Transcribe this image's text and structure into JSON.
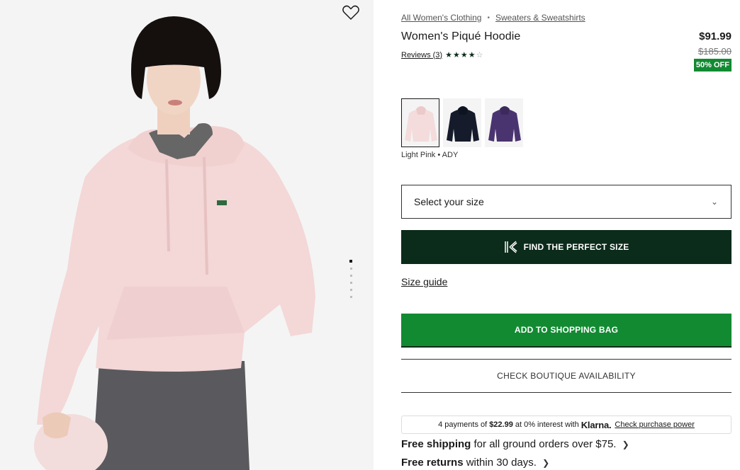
{
  "breadcrumb": {
    "items": [
      "All Women's Clothing",
      "Sweaters & Sweatshirts"
    ],
    "separator": "•"
  },
  "product": {
    "title": "Women's Piqué Hoodie",
    "price": "$91.99",
    "old_price": "$185.00",
    "discount_badge": "50% OFF",
    "reviews_label": "Reviews (3)",
    "rating": 4,
    "rating_max": 5,
    "color_label": "Light Pink • ADY"
  },
  "swatches": [
    {
      "name": "Light Pink",
      "color": "#f4dcdc",
      "selected": true
    },
    {
      "name": "Navy",
      "color": "#151b2b",
      "selected": false
    },
    {
      "name": "Purple",
      "color": "#4a3470",
      "selected": false
    }
  ],
  "size_select": {
    "placeholder": "Select your size"
  },
  "buttons": {
    "perfect_size": "FIND THE PERFECT SIZE",
    "size_guide": "Size guide",
    "add_to_bag": "ADD TO SHOPPING BAG",
    "boutique": "CHECK BOUTIQUE AVAILABILITY"
  },
  "klarna": {
    "prefix": "4 payments of",
    "amount": "$22.99",
    "middle": "at 0% interest with",
    "brand": "Klarna.",
    "link": "Check purchase power"
  },
  "shipping": {
    "bold": "Free shipping",
    "rest": "for all ground orders over $75."
  },
  "returns": {
    "bold": "Free returns",
    "rest": "within 30 days."
  },
  "gallery": {
    "image_count": 6,
    "active_index": 0
  },
  "colors": {
    "dark_green": "#0b2b1b",
    "brand_green": "#128a32",
    "hoodie_pink": "#f4dcdc"
  }
}
